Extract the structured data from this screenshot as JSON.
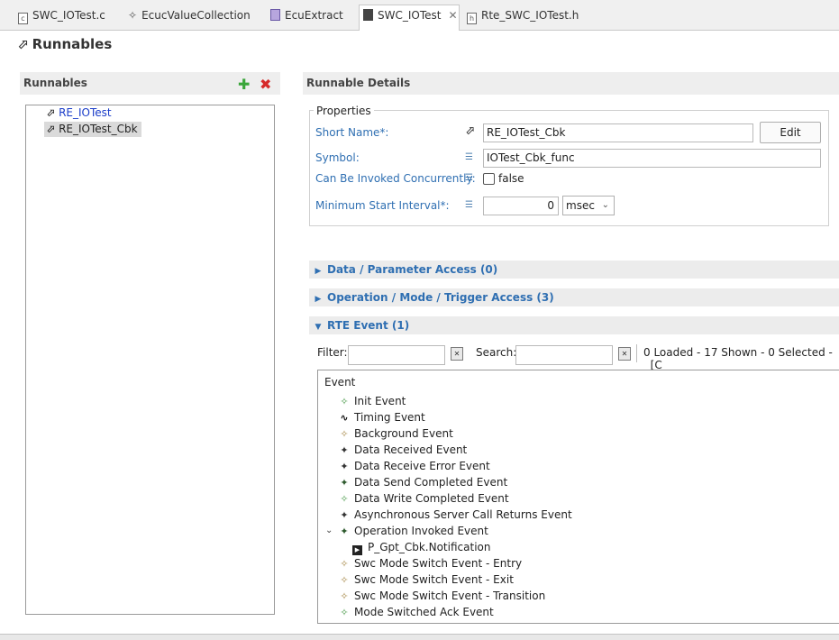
{
  "tabs": [
    {
      "label": "SWC_IOTest.c",
      "icon": "c-file-icon"
    },
    {
      "label": "EcucValueCollection",
      "icon": "ecuc-icon"
    },
    {
      "label": "EcuExtract",
      "icon": "ecu-extract-icon"
    },
    {
      "label": "SWC_IOTest",
      "icon": "swc-icon",
      "active": true
    },
    {
      "label": "Rte_SWC_IOTest.h",
      "icon": "h-file-icon"
    }
  ],
  "page": {
    "title": "Runnables"
  },
  "runnables_panel": {
    "title": "Runnables",
    "items": [
      {
        "label": "RE_IOTest"
      },
      {
        "label": "RE_IOTest_Cbk",
        "selected": true
      }
    ]
  },
  "details": {
    "title": "Runnable Details",
    "properties_label": "Properties",
    "short_name": {
      "label": "Short Name*:",
      "value": "RE_IOTest_Cbk",
      "edit_label": "Edit"
    },
    "symbol": {
      "label": "Symbol:",
      "value": "IOTest_Cbk_func"
    },
    "concurrent": {
      "label": "Can Be Invoked Concurrently:",
      "value": "false"
    },
    "min_start": {
      "label": "Minimum Start Interval*:",
      "value": "0",
      "unit": "msec"
    }
  },
  "sections": {
    "data_access": "Data / Parameter Access (0)",
    "operation_access": "Operation / Mode / Trigger Access (3)",
    "rte_event": "RTE Event (1)"
  },
  "filter": {
    "filter_label": "Filter:",
    "search_label": "Search:",
    "status": "0 Loaded - 17 Shown - 0 Selected -",
    "status_suffix": "[C"
  },
  "events": {
    "header": "Event",
    "items": [
      {
        "label": "Init Event",
        "icon": "event-green-icon"
      },
      {
        "label": "Timing Event",
        "icon": "timing-wave-icon"
      },
      {
        "label": "Background Event",
        "icon": "event-tan-icon"
      },
      {
        "label": "Data Received Event",
        "icon": "event-dark-icon"
      },
      {
        "label": "Data Receive Error Event",
        "icon": "event-dark-icon"
      },
      {
        "label": "Data Send Completed Event",
        "icon": "event-dark-icon"
      },
      {
        "label": "Data Write Completed Event",
        "icon": "event-green-icon"
      },
      {
        "label": "Asynchronous Server Call Returns Event",
        "icon": "event-dark-icon"
      },
      {
        "label": "Operation Invoked Event",
        "icon": "event-dark-icon",
        "expanded": true
      },
      {
        "label": "P_Gpt_Cbk.Notification",
        "icon": "operation-port-icon",
        "child": true
      },
      {
        "label": "Swc Mode Switch Event - Entry",
        "icon": "event-tan-icon"
      },
      {
        "label": "Swc Mode Switch Event - Exit",
        "icon": "event-tan-icon"
      },
      {
        "label": "Swc Mode Switch Event - Transition",
        "icon": "event-tan-icon"
      },
      {
        "label": "Mode Switched Ack Event",
        "icon": "event-green-icon"
      }
    ]
  },
  "colors": {
    "link": "#1a3cc9",
    "field_label": "#2f6fb2",
    "add": "#3aa53a",
    "delete": "#d62a2a"
  }
}
